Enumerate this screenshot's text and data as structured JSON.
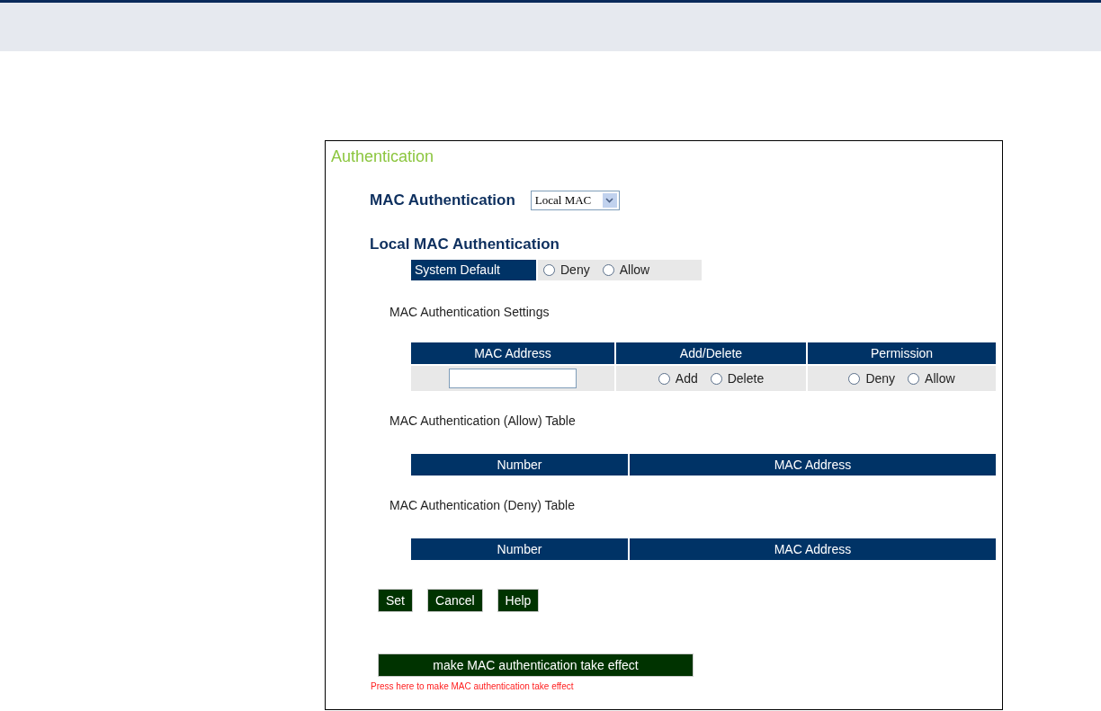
{
  "panel": {
    "title": "Authentication"
  },
  "mac_authentication": {
    "label": "MAC Authentication",
    "select_value": "Local MAC"
  },
  "local_section": {
    "heading": "Local MAC Authentication",
    "system_default": {
      "label": "System Default",
      "options": [
        {
          "label": "Deny",
          "selected": false
        },
        {
          "label": "Allow",
          "selected": false
        }
      ]
    }
  },
  "settings": {
    "heading": "MAC Authentication Settings",
    "columns": [
      "MAC Address",
      "Add/Delete",
      "Permission"
    ],
    "action_options": [
      {
        "label": "Add",
        "selected": false
      },
      {
        "label": "Delete",
        "selected": false
      }
    ],
    "permission_options": [
      {
        "label": "Deny",
        "selected": false
      },
      {
        "label": "Allow",
        "selected": false
      }
    ]
  },
  "tables": [
    {
      "heading": "MAC Authentication (Allow) Table",
      "columns": [
        "Number",
        "MAC Address"
      ]
    },
    {
      "heading": "MAC Authentication (Deny) Table",
      "columns": [
        "Number",
        "MAC Address"
      ]
    }
  ],
  "buttons": [
    "Set",
    "Cancel",
    "Help"
  ],
  "apply_button": "make MAC authentication take effect",
  "apply_hint": "Press here to make MAC authentication take effect"
}
